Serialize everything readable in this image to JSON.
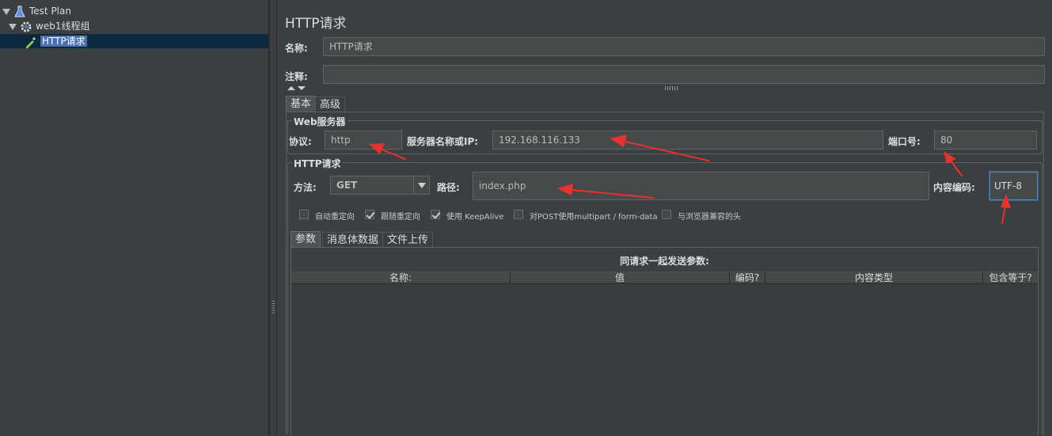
{
  "tree": {
    "items": [
      {
        "label": "Test Plan"
      },
      {
        "label": "web1线程组"
      },
      {
        "label": "HTTP请求"
      }
    ]
  },
  "panel": {
    "title": "HTTP请求",
    "name_label": "名称:",
    "name_value": "HTTP请求",
    "comment_label": "注释:",
    "comment_value": "",
    "tabs": [
      {
        "label": "基本"
      },
      {
        "label": "高级"
      }
    ]
  },
  "web_server": {
    "title": "Web服务器",
    "protocol_label": "协议:",
    "protocol_value": "http",
    "server_label": "服务器名称或IP:",
    "server_value": "192.168.116.133",
    "port_label": "端口号:",
    "port_value": "80"
  },
  "http_request": {
    "title": "HTTP请求",
    "method_label": "方法:",
    "method_value": "GET",
    "path_label": "路径:",
    "path_value": "index.php",
    "encoding_label": "内容编码:",
    "encoding_value": "UTF-8",
    "options": [
      {
        "label": "自动重定向",
        "checked": false
      },
      {
        "label": "跟随重定向",
        "checked": true
      },
      {
        "label": "使用 KeepAlive",
        "checked": true
      },
      {
        "label": "对POST使用multipart / form-data",
        "checked": false
      },
      {
        "label": "与浏览器兼容的头",
        "checked": false
      }
    ]
  },
  "params": {
    "tabs": [
      {
        "label": "参数"
      },
      {
        "label": "消息体数据"
      },
      {
        "label": "文件上传"
      }
    ],
    "caption": "同请求一起发送参数:",
    "columns": [
      "名称:",
      "值",
      "编码?",
      "内容类型",
      "包含等于?"
    ]
  },
  "colors": {
    "background": "#3c3f41",
    "field": "#45494a",
    "selection": "#4b6eaf",
    "annotation_arrow": "#e8322e"
  }
}
